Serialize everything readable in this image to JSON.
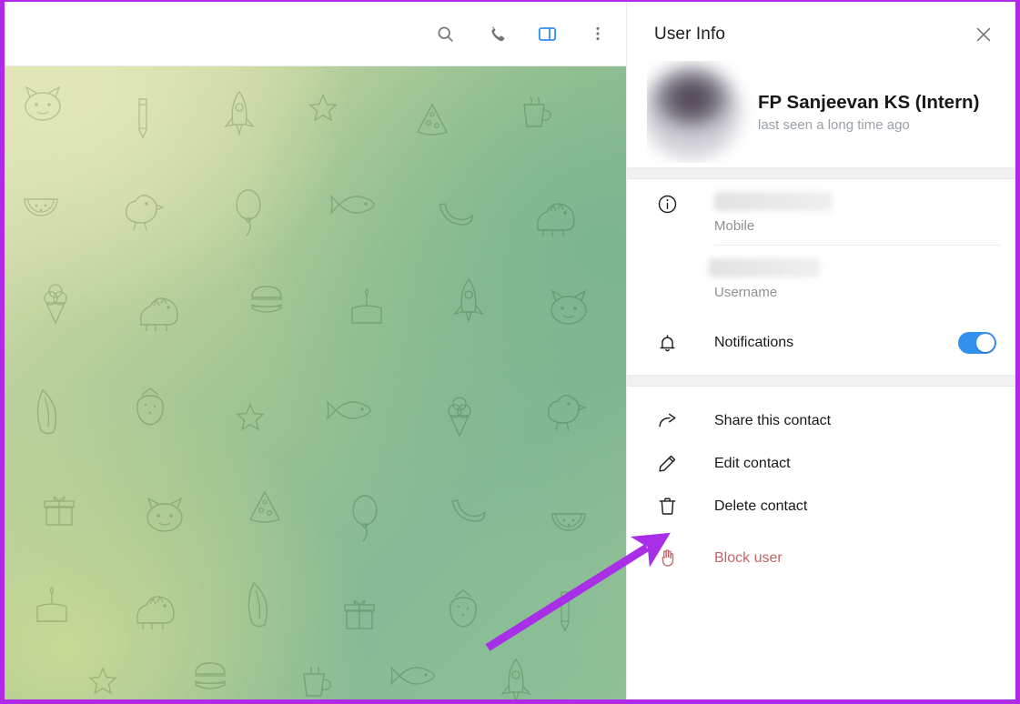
{
  "window": {
    "border_color": "#b028e8",
    "annotation_arrow_color": "#a82ee8"
  },
  "chat": {
    "toolbar": {
      "buttons": [
        {
          "name": "search-icon",
          "label": "Search",
          "active": false
        },
        {
          "name": "phone-icon",
          "label": "Call",
          "active": false
        },
        {
          "name": "sidebar-toggle-icon",
          "label": "Toggle Info",
          "active": true
        },
        {
          "name": "more-vertical-icon",
          "label": "More",
          "active": false
        }
      ]
    },
    "wallpaper": {
      "style": "telegram-doodle-pattern",
      "colors": [
        "#dfe5b4",
        "#c2d49f",
        "#9cc392",
        "#86b894"
      ]
    }
  },
  "panel": {
    "title": "User Info",
    "close_label": "Close",
    "profile": {
      "name": "FP Sanjeevan KS (Intern)",
      "status": "last seen a long time ago",
      "avatar_redacted": true
    },
    "info_icon_name": "info-circle-icon",
    "fields": [
      {
        "label": "Mobile",
        "value": "",
        "redacted": true
      },
      {
        "label": "Username",
        "value": "",
        "redacted": true
      }
    ],
    "notifications": {
      "icon_name": "bell-icon",
      "label": "Notifications",
      "enabled": true,
      "toggle_color": "#3390ec"
    },
    "actions": [
      {
        "label": "Share this contact",
        "icon": "share-arrow-icon",
        "danger": false
      },
      {
        "label": "Edit contact",
        "icon": "pencil-icon",
        "danger": false
      },
      {
        "label": "Delete contact",
        "icon": "trash-icon",
        "danger": false
      },
      {
        "label": "Block user",
        "icon": "block-hand-icon",
        "danger": true,
        "color": "#c2656a"
      }
    ]
  }
}
